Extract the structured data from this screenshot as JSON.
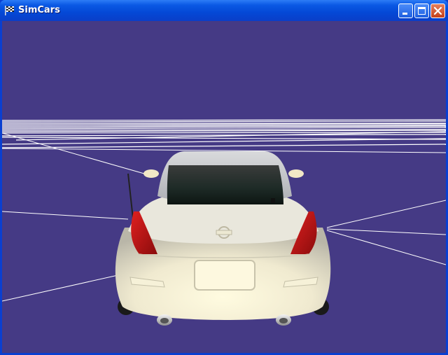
{
  "window": {
    "title": "SimCars",
    "app_icon": "checkered-flag-icon",
    "buttons": [
      "minimize-icon",
      "maximize-icon",
      "close-icon"
    ]
  },
  "scene": {
    "sky_color": "#453a85",
    "car_color": "#f3efd6",
    "taillight_color": "#c01616"
  }
}
